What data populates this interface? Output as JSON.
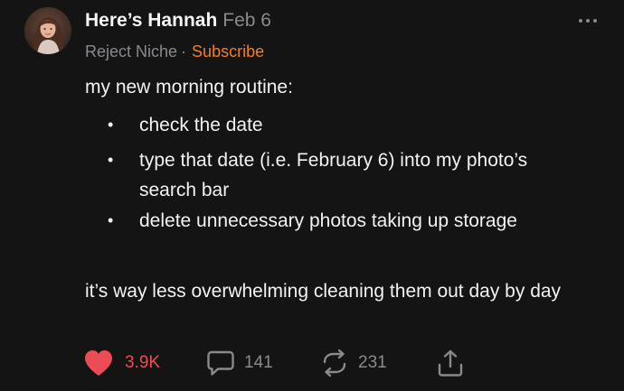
{
  "author": {
    "name": "Here’s Hannah",
    "date": "Feb 6"
  },
  "publication": {
    "name": "Reject Niche",
    "separator": "·",
    "subscribe_label": "Subscribe"
  },
  "post": {
    "intro": "my new morning routine:",
    "bullets": [
      "check the date",
      "type that date (i.e. February 6) into my photo’s search bar",
      "delete unnecessary photos taking up storage"
    ],
    "bullet_marker": "•",
    "outro": "it’s way less overwhelming cleaning them out day by day"
  },
  "actions": {
    "likes": "3.9K",
    "comments": "141",
    "restacks": "231"
  },
  "icons": {
    "like": "heart-icon",
    "comment": "comment-bubble-icon",
    "restack": "restack-arrows-icon",
    "share": "share-upload-icon",
    "more": "more-options-icon"
  },
  "colors": {
    "background": "#141415",
    "text": "#f2f2f2",
    "muted": "#8a8a8e",
    "accent": "#f07f24",
    "like": "#ec4c55"
  }
}
